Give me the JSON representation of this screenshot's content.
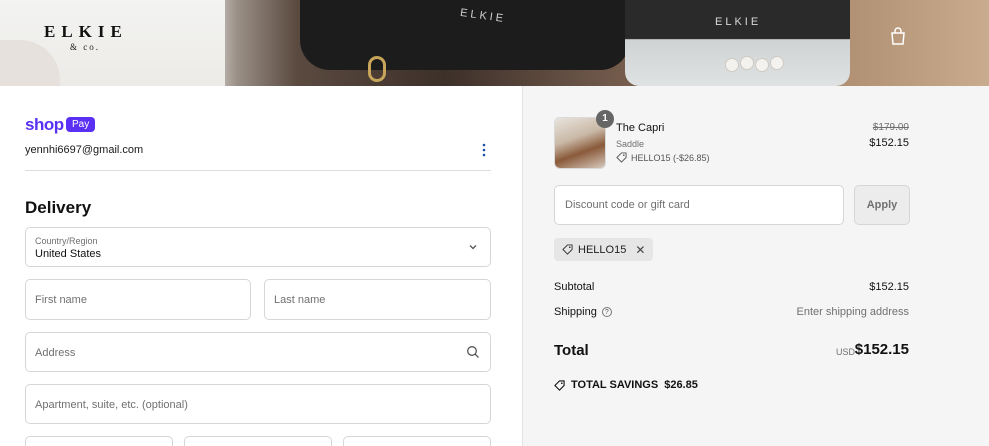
{
  "header": {
    "brand": "ELKIE",
    "brand_sub": "& co.",
    "pouch_text": "ELKIE",
    "pouch2_text": "ELKIE"
  },
  "account": {
    "shop_label": "shop",
    "pay_label": "Pay",
    "email": "yennhi6697@gmail.com"
  },
  "delivery": {
    "title": "Delivery",
    "country_label": "Country/Region",
    "country_value": "United States",
    "first_name_placeholder": "First name",
    "last_name_placeholder": "Last name",
    "address_placeholder": "Address",
    "apartment_placeholder": "Apartment, suite, etc. (optional)"
  },
  "order": {
    "item": {
      "quantity": "1",
      "name": "The Capri",
      "variant": "Saddle",
      "discount": "HELLO15 (-$26.85)",
      "original_price": "$179.00",
      "price": "$152.15"
    },
    "discount_placeholder": "Discount code or gift card",
    "apply_label": "Apply",
    "applied_code": "HELLO15",
    "subtotal_label": "Subtotal",
    "subtotal_value": "$152.15",
    "shipping_label": "Shipping",
    "shipping_value": "Enter shipping address",
    "total_label": "Total",
    "total_currency": "USD",
    "total_value": "$152.15",
    "savings_label": "TOTAL SAVINGS",
    "savings_value": "$26.85"
  },
  "colors": {
    "shop_purple": "#5a31f4",
    "right_panel_bg": "#f5f5f5"
  }
}
